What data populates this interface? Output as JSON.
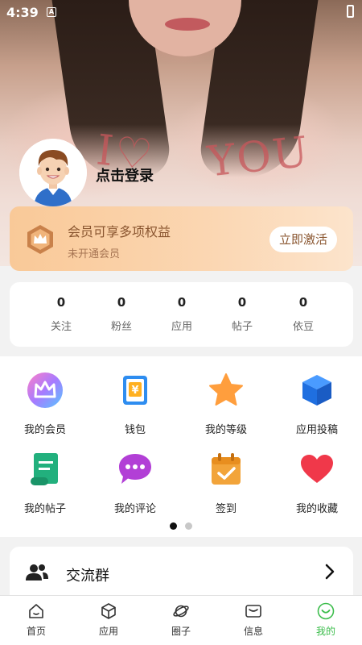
{
  "status_bar": {
    "time": "4:39"
  },
  "profile": {
    "login_text": "点击登录"
  },
  "vip": {
    "title": "会员可享多项权益",
    "subtitle": "未开通会员",
    "button": "立即激活"
  },
  "stats": [
    {
      "value": "0",
      "label": "关注"
    },
    {
      "value": "0",
      "label": "粉丝"
    },
    {
      "value": "0",
      "label": "应用"
    },
    {
      "value": "0",
      "label": "帖子"
    },
    {
      "value": "0",
      "label": "依豆"
    }
  ],
  "grid": [
    {
      "label": "我的会员",
      "icon": "crown-icon"
    },
    {
      "label": "钱包",
      "icon": "wallet-icon"
    },
    {
      "label": "我的等级",
      "icon": "star-icon"
    },
    {
      "label": "应用投稿",
      "icon": "cube-icon"
    },
    {
      "label": "我的帖子",
      "icon": "scroll-icon"
    },
    {
      "label": "我的评论",
      "icon": "chat-icon"
    },
    {
      "label": "签到",
      "icon": "calendar-check-icon"
    },
    {
      "label": "我的收藏",
      "icon": "heart-icon"
    }
  ],
  "pager": {
    "pages": 2,
    "current": 1
  },
  "group": {
    "label": "交流群"
  },
  "tabs": [
    {
      "label": "首页",
      "icon": "home-icon"
    },
    {
      "label": "应用",
      "icon": "box-icon"
    },
    {
      "label": "圈子",
      "icon": "planet-icon"
    },
    {
      "label": "信息",
      "icon": "message-icon"
    },
    {
      "label": "我的",
      "icon": "profile-icon",
      "active": true
    }
  ],
  "colors": {
    "accent": "#3bbd4b",
    "vip_text": "#8a5630",
    "vip_bg": "#f9c998"
  }
}
